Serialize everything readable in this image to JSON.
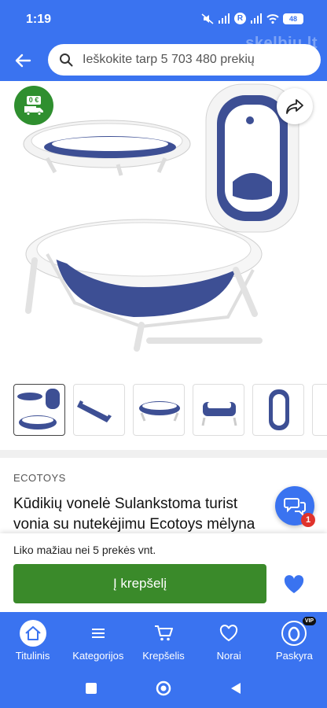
{
  "status_bar": {
    "time": "1:19",
    "battery": "48",
    "r_badge": "R"
  },
  "watermark": "skelbiu.lt",
  "header": {
    "search_placeholder": "Ieškokite tarp 5 703 480 prekių"
  },
  "product": {
    "price_badge": "0 €",
    "brand": "ECOTOYS",
    "title_line1": "Kūdikių vonelė Sulankstoma turist",
    "title_line2": "vonia su nutekėjimu Ecotoys mėlyna",
    "thumbnail_count": 6,
    "active_thumbnail": 1
  },
  "chat": {
    "unread": "1"
  },
  "purchase": {
    "stock_text": "Liko mažiau nei 5 prekės vnt.",
    "cart_label": "Į krepšelį"
  },
  "bottom_nav": {
    "items": [
      {
        "label": "Titulinis",
        "icon": "home-icon"
      },
      {
        "label": "Kategorijos",
        "icon": "menu-icon"
      },
      {
        "label": "Krepšelis",
        "icon": "cart-icon"
      },
      {
        "label": "Norai",
        "icon": "heart-icon"
      },
      {
        "label": "Paskyra",
        "icon": "account-icon"
      }
    ],
    "vip_badge": "VIP"
  },
  "colors": {
    "brand_blue": "#3a73f0",
    "cart_green": "#3a8a2a",
    "badge_green": "#2f8f2f",
    "tub_blue": "#3d4f94",
    "notification_red": "#e0332c"
  }
}
